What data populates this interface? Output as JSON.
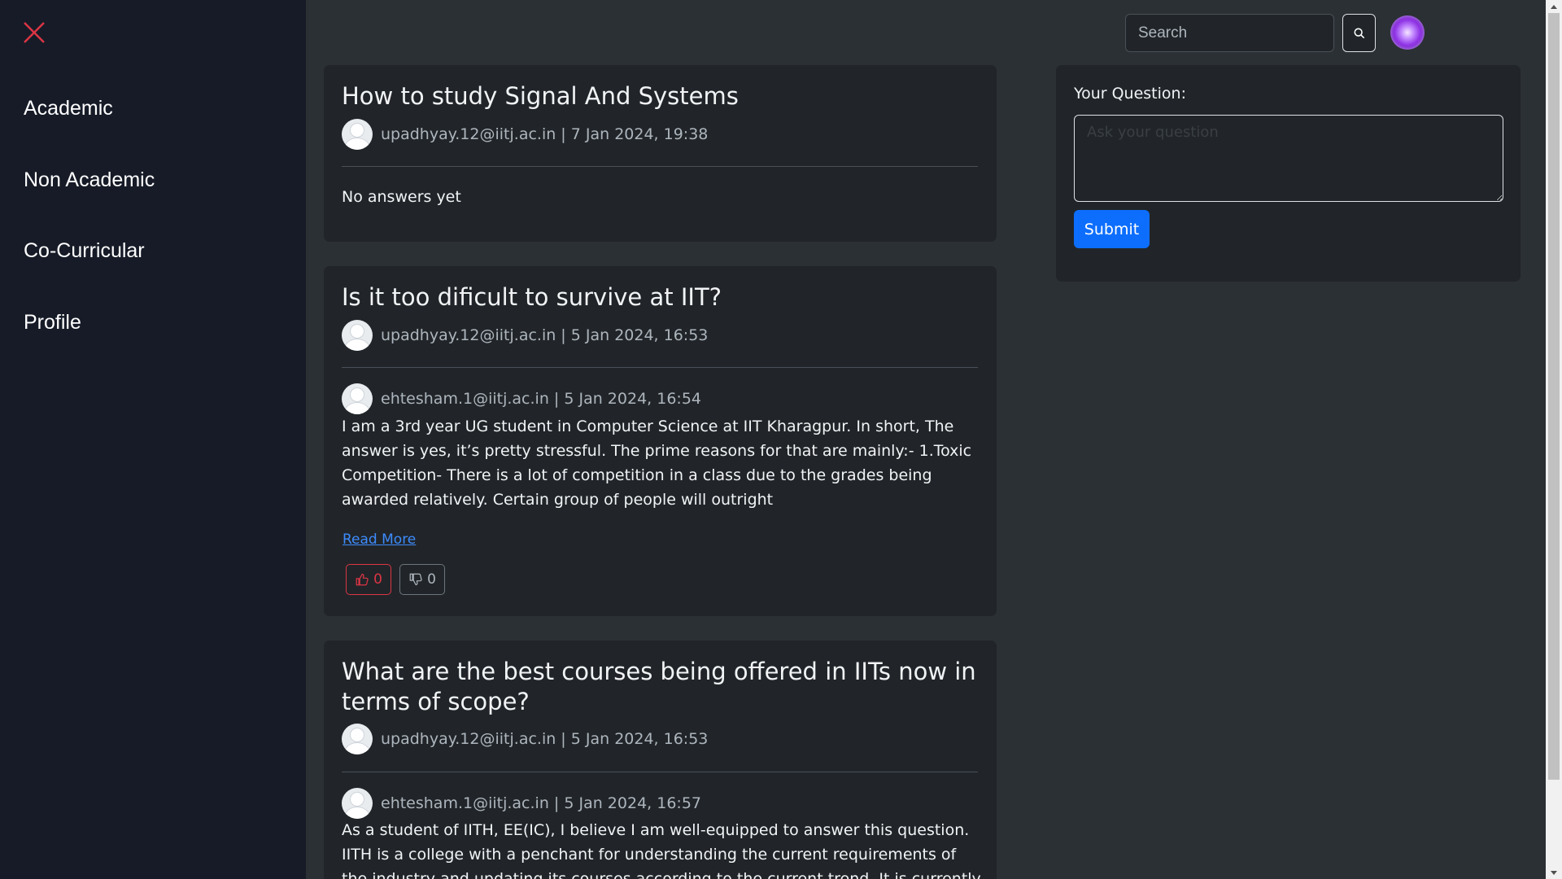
{
  "sidebar": {
    "close_icon": "close-x-icon",
    "close_color": "#dc3545",
    "items": [
      {
        "label": "Academic"
      },
      {
        "label": "Non Academic"
      },
      {
        "label": "Co-Curricular"
      },
      {
        "label": "Profile"
      }
    ]
  },
  "header": {
    "search": {
      "placeholder": "Search",
      "value": ""
    },
    "search_icon": "search-icon",
    "avatar_icon": "user-avatar-icon"
  },
  "questions": [
    {
      "title": "How to study Signal And Systems",
      "meta": "upadhyay.12@iitj.ac.in | 7 Jan 2024, 19:38",
      "empty_text": "No answers yet"
    },
    {
      "title": "Is it too dificult to survive at IIT?",
      "meta": "upadhyay.12@iitj.ac.in | 5 Jan 2024, 16:53",
      "answer": {
        "meta": "ehtesham.1@iitj.ac.in | 5 Jan 2024, 16:54",
        "text": "I am a 3rd year UG student in Computer Science at IIT Kharagpur. In short, The answer is yes, it’s pretty stressful. The prime reasons for that are mainly:- 1.Toxic Competition- There is a lot of competition in a class due to the grades being awarded relatively. Certain group of people will outright",
        "read_more": "Read More",
        "upvotes": "0",
        "downvotes": "0"
      }
    },
    {
      "title": "What are the best courses being offered in IITs now in terms of scope?",
      "meta": "upadhyay.12@iitj.ac.in | 5 Jan 2024, 16:53",
      "answer": {
        "meta": "ehtesham.1@iitj.ac.in | 5 Jan 2024, 16:57",
        "text": "As a student of IITH, EE(IC), I believe I am well-equipped to answer this question. IITH is a college with a penchant for understanding the current requirements of the industry and updating its courses according to the current trend. It is currently the fastest-growing IIT and"
      }
    }
  ],
  "ask": {
    "label": "Your Question:",
    "placeholder": "Ask your question",
    "value": "",
    "submit_label": "Submit",
    "submit_color": "#0d6efd"
  },
  "colors": {
    "sidebar_bg": "#161b27",
    "page_bg": "#2b3035",
    "card_bg": "#212529",
    "upvote": "#dc3545",
    "link": "#3d8bfd"
  }
}
